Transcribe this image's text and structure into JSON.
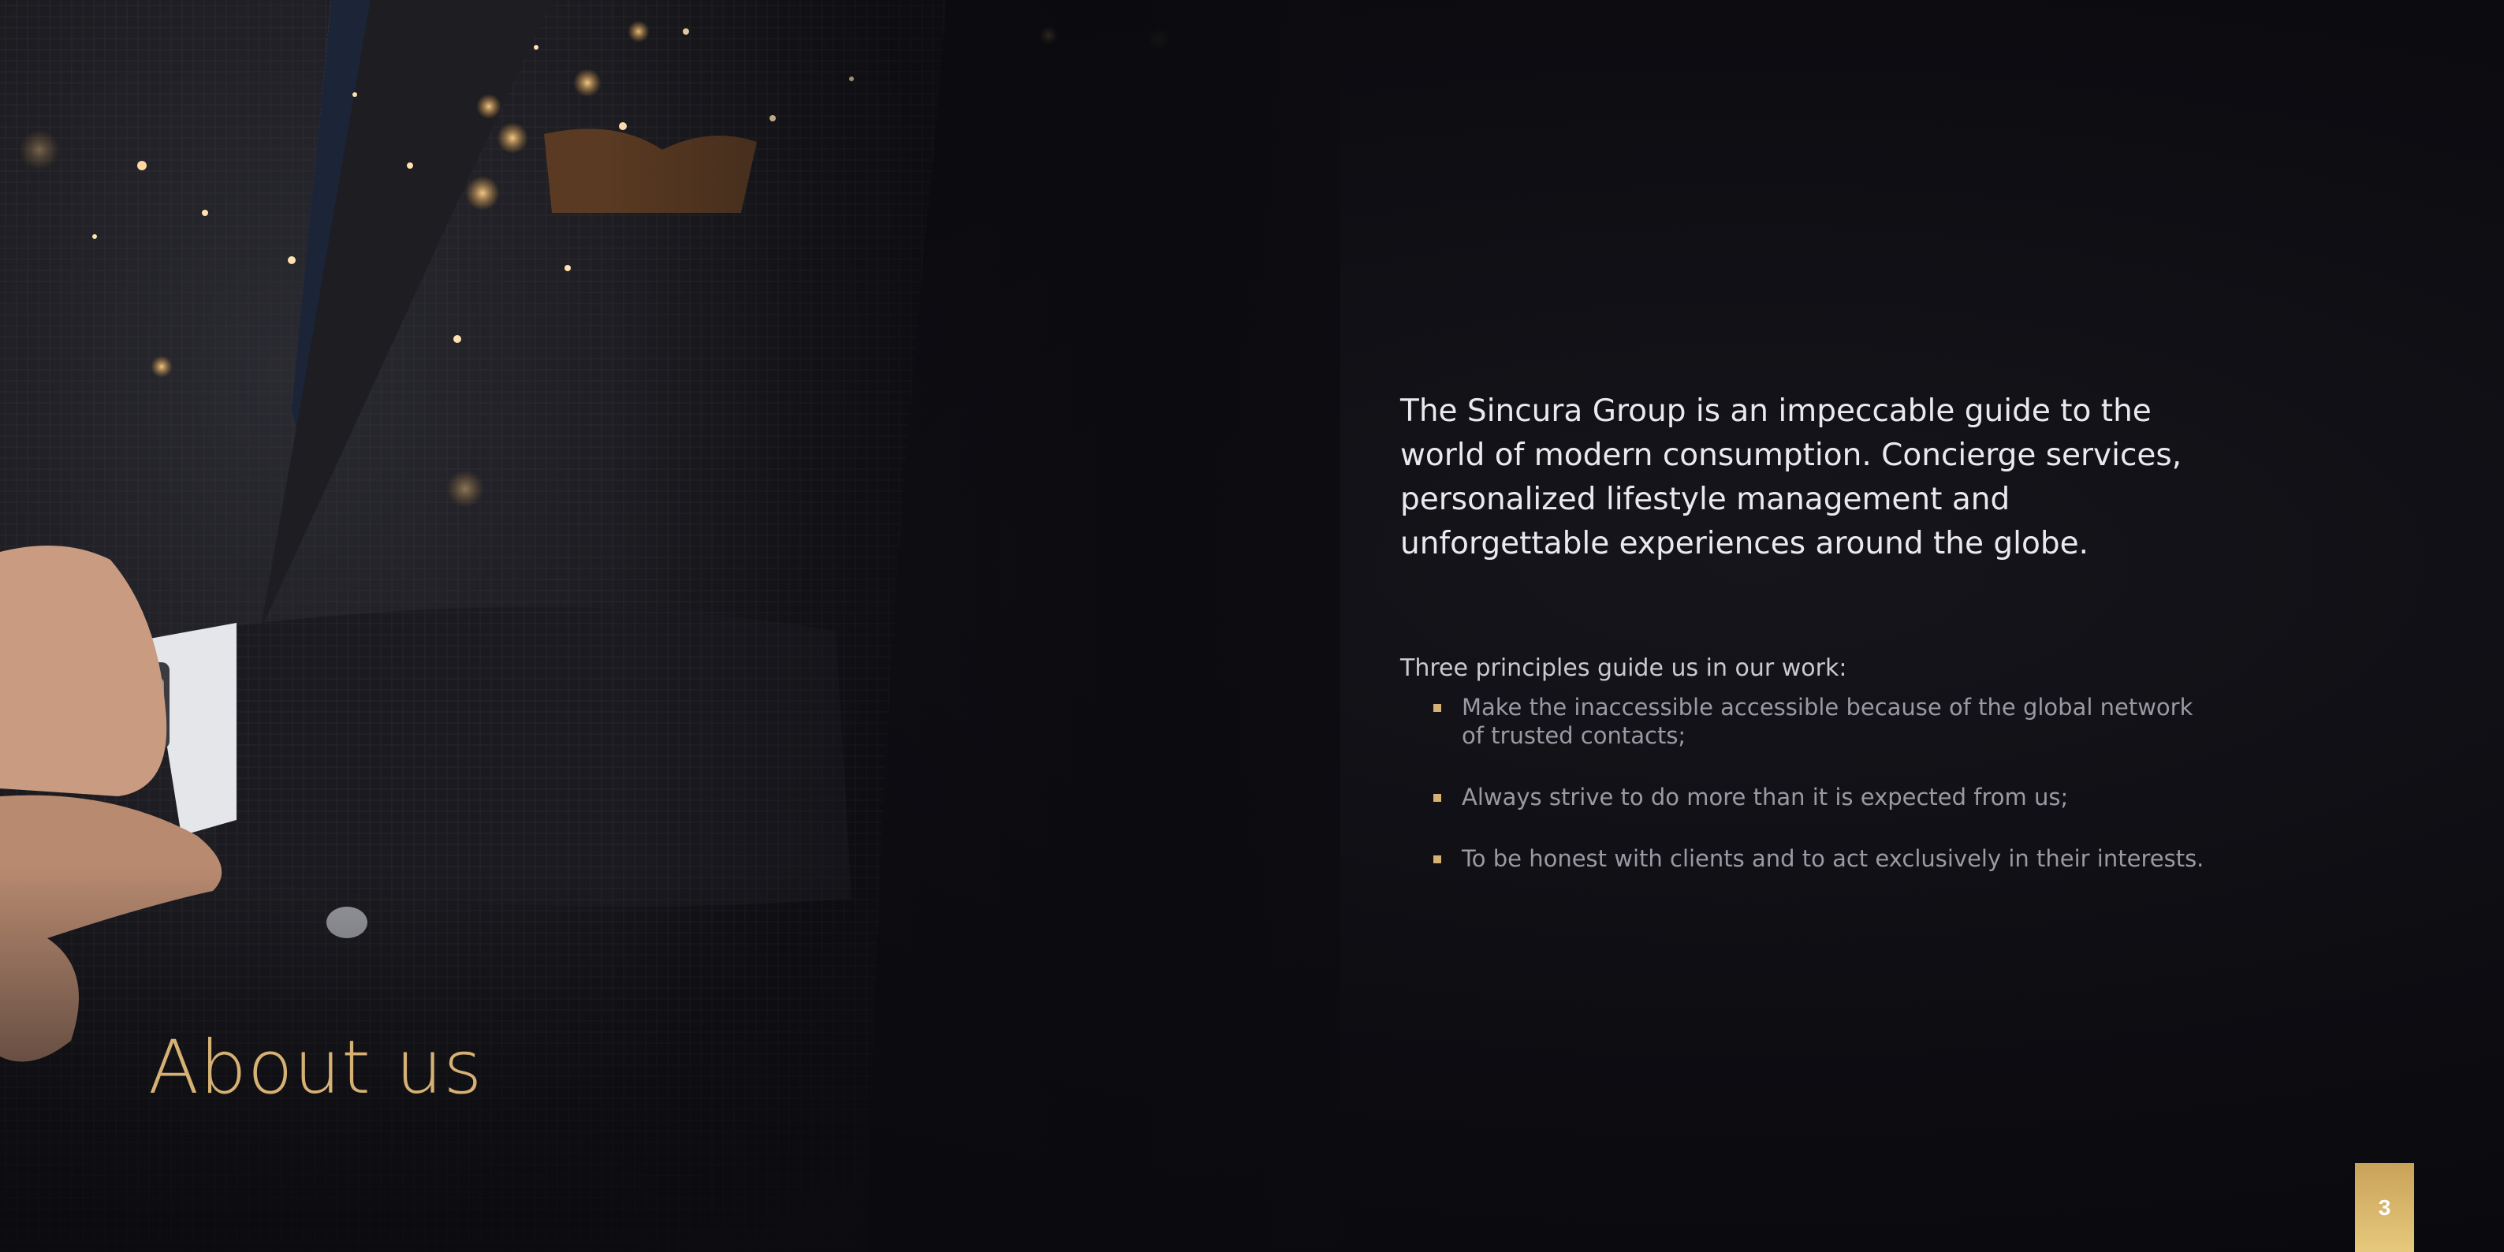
{
  "title": "About us",
  "lead": "The Sincura Group is an impeccable guide to the world of modern consumption. Concierge services, personalized lifestyle management and unforgettable experiences around the globe.",
  "principles_intro": "Three principles guide us in our work:",
  "principles": [
    "Make the inaccessible accessible because of the global network of trusted contacts;",
    "Always strive to do more than it is expected from us;",
    "To be honest with clients and to act exclusively in their interests."
  ],
  "page_number": "3",
  "colors": {
    "accent_gold": "#d6b173",
    "background": "#0b0b0f",
    "lead_text": "#e9e9ee",
    "body_text": "#9a9aa3"
  }
}
